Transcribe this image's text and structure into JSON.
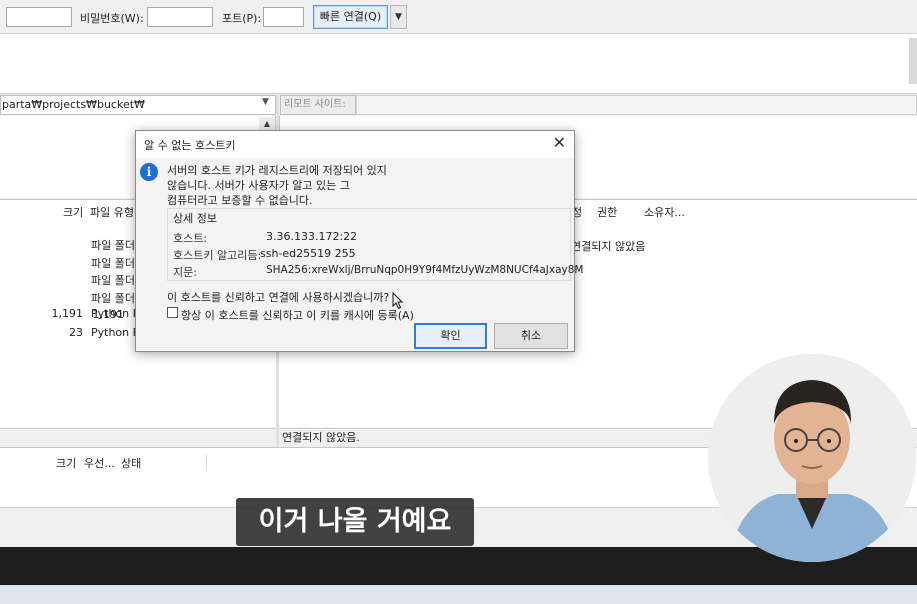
{
  "quickconnect": {
    "password_label": "비밀번호(W):",
    "port_label": "포트(P):",
    "connect_button": "빠른 연결(Q)"
  },
  "local": {
    "path": "parta₩projects₩bucket₩",
    "columns": [
      "크기",
      "파일 유형"
    ],
    "rows": [
      {
        "size": "",
        "type": "파일 폴더"
      },
      {
        "size": "",
        "type": "파일 폴더"
      },
      {
        "size": "",
        "type": "파일 폴더"
      },
      {
        "size": "",
        "type": "파일 폴더"
      },
      {
        "size": "1,191",
        "type": "Python Fi"
      },
      {
        "size": "23",
        "type": "Python Fi"
      }
    ]
  },
  "remote": {
    "site_label": "리모트 사이트:",
    "columns": [
      "정",
      "권한",
      "소유자..."
    ],
    "not_connected_msg": "연결되지 않았음",
    "status": "연결되지 않았음."
  },
  "queue": {
    "columns": [
      "크기",
      "우선...",
      "상태"
    ]
  },
  "dialog": {
    "title": "알 수 없는 호스트키",
    "message_lines": [
      "서버의 호스트 키가 레지스트리에 저장되어 있지",
      "않습니다. 서버가 사용자가 알고 있는 그",
      "컴퓨터라고 보증할 수 없습니다."
    ],
    "details_title": "상세 정보",
    "details": [
      {
        "key": "호스트:",
        "value": "3.36.133.172:22"
      },
      {
        "key": "호스트키 알고리듬:",
        "value": "ssh-ed25519 255"
      },
      {
        "key": "지문:",
        "value": "SHA256:xreWxlj/BrruNqp0H9Y9f4MfzUyWzM8NUCf4aJxay8M"
      }
    ],
    "question": "이 호스트를 신뢰하고 연결에 사용하시겠습니까?",
    "always_trust": "항상 이 호스트를 신뢰하고 이 키를 캐시에 등록(A)",
    "ok": "확인",
    "cancel": "취소"
  },
  "subtitle": "이거 나올 거예요"
}
